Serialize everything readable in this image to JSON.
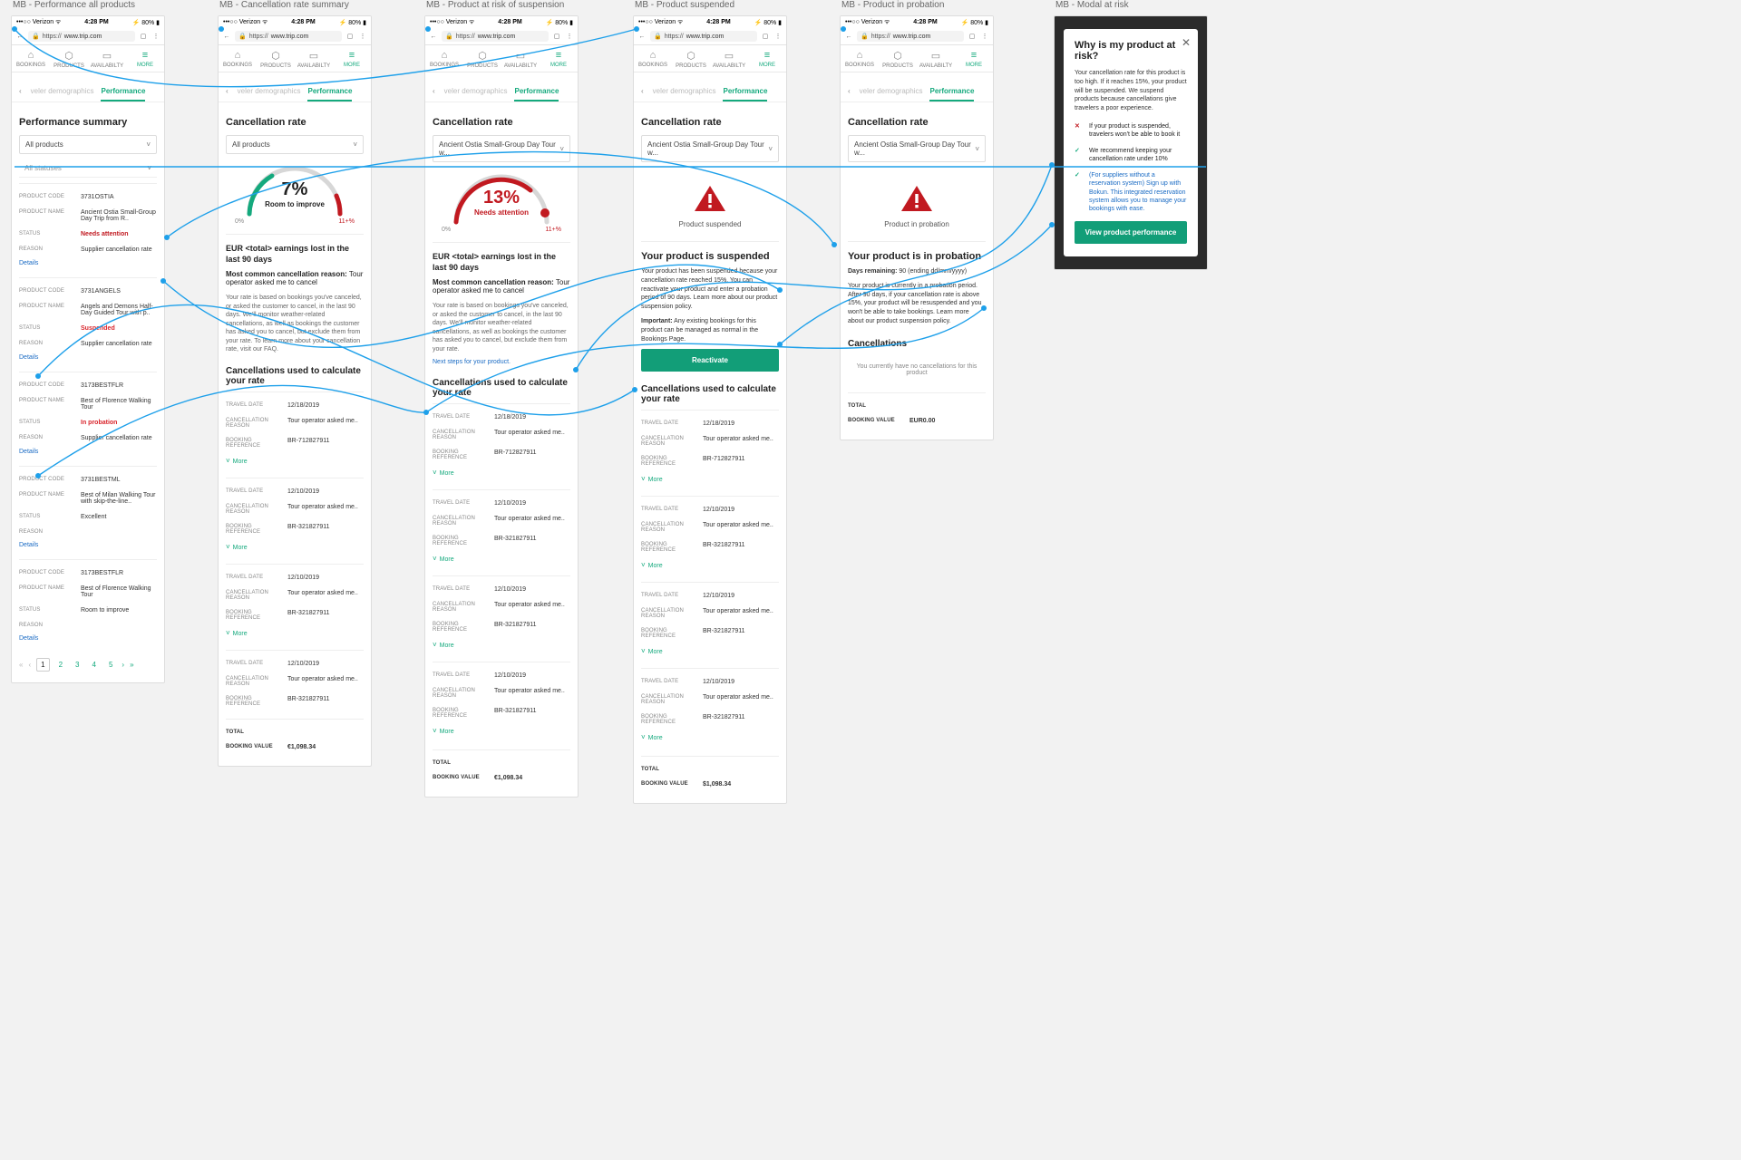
{
  "statusbar": {
    "carrier": "•••○○ Verizon ᯤ",
    "time": "4:28 PM",
    "battery": "⚡ 80% ▮"
  },
  "browser": {
    "url_prefix": "https://",
    "url": "www.trip.com"
  },
  "topnav": {
    "bookings": "BOOKINGS",
    "products": "PRODUCTS",
    "availability": "AVAILABILTY",
    "more": "MORE"
  },
  "subtabs": {
    "demographics": "veler demographics",
    "performance": "Performance"
  },
  "columns": {
    "c1": {
      "title": "MB - Performance all products"
    },
    "c2": {
      "title": "MB - Cancellation rate summary"
    },
    "c3": {
      "title": "MB - Product at risk of suspension"
    },
    "c4": {
      "title": "MB - Product suspended"
    },
    "c5": {
      "title": "MB - Product in probation"
    },
    "c6": {
      "title": "MB - Modal at risk"
    }
  },
  "perf": {
    "heading": "Performance summary",
    "filter1": "All products",
    "filter2": "All statuses",
    "field_labels": {
      "code": "PRODUCT CODE",
      "name": "PRODUCT NAME",
      "status": "STATUS",
      "reason": "REASON"
    },
    "details": "Details",
    "products": [
      {
        "code": "3731OSTIA",
        "name": "Ancient Ostia Small-Group Day Trip from R..",
        "status": "Needs attention",
        "status_class": "needs",
        "reason": "Supplier cancellation rate"
      },
      {
        "code": "3731ANGELS",
        "name": "Angels and Demons Half-Day Guided Tour with p..",
        "status": "Suspended",
        "status_class": "susp",
        "reason": "Supplier cancellation rate"
      },
      {
        "code": "3173BESTFLR",
        "name": "Best of Florence Walking Tour",
        "status": "In probation",
        "status_class": "prob",
        "reason": "Supplier cancellation rate"
      },
      {
        "code": "3731BESTML",
        "name": "Best of Milan Walking Tour with skip-the-line..",
        "status": "Excellent",
        "status_class": "",
        "reason": ""
      },
      {
        "code": "3173BESTFLR",
        "name": "Best of Florence Walking Tour",
        "status": "Room to improve",
        "status_class": "",
        "reason": ""
      }
    ],
    "pager": [
      "1",
      "2",
      "3",
      "4",
      "5"
    ]
  },
  "cxl": {
    "heading": "Cancellation rate",
    "filter_all": "All products",
    "filter_ostia": "Ancient Ostia Small-Group Day Tour w...",
    "gauge7": {
      "pct": "7%",
      "caption": "Room to improve"
    },
    "gauge13": {
      "pct": "13%",
      "caption": "Needs attention"
    },
    "gauge_labels": {
      "left": "0%",
      "right": "11+%"
    },
    "earnings": "EUR <total> earnings lost in the last 90 days",
    "common_reason_label": "Most common cancellation reason:",
    "common_reason_value": " Tour operator asked me to cancel",
    "fineprint_c2": "Your rate is based on bookings you've canceled, or asked the customer to cancel, in the last 90 days. We'll monitor weather-related cancellations, as well as bookings the customer has asked you to cancel, but exclude them from your rate. To learn more about your cancellation rate, visit our FAQ.",
    "fineprint_c3": "Your rate is based on bookings you've canceled, or asked the customer to cancel, in the last 90 days. We'll monitor weather-related cancellations, as well as bookings the customer has asked you to cancel, but exclude them from your rate.",
    "next_steps": "Next steps for your product.",
    "used_heading": "Cancellations used to calculate your rate",
    "row_labels": {
      "travel": "TRAVEL DATE",
      "reason": "CANCELLATION REASON",
      "ref": "BOOKING REFERENCE"
    },
    "more": "More",
    "row1": {
      "date": "12/18/2019",
      "reason": "Tour operator asked me..",
      "ref": "BR-712827911"
    },
    "row2": {
      "date": "12/10/2019",
      "reason": "Tour operator asked me..",
      "ref": "BR-321827911"
    },
    "total_label": "TOTAL",
    "booking_value_label": "BOOKING VALUE",
    "booking_value_eur": "€1,098.34",
    "booking_value_usd": "$1,098.34"
  },
  "suspended": {
    "icon_caption": "Product suspended",
    "title": "Your product is suspended",
    "body": "Your product has been suspended because your cancellation rate reached 15%. You can reactivate your product and enter a probation period of 90 days. Learn more about our product suspension policy.",
    "important_label": "Important:",
    "important_body": " Any existing bookings for this product can be managed as normal in the Bookings Page.",
    "cta": "Reactivate"
  },
  "probation": {
    "icon_caption": "Product in probation",
    "title": "Your product is in probation",
    "days_label": "Days remaining:",
    "days_value": " 90 (ending dd/mm/yyyy)",
    "body": "Your product is currently in a probation period. After 90 days, if your cancellation rate is above 15%, your product will be resuspended and you won't be able to take bookings. Learn more about our product suspension policy.",
    "cxl_heading": "Cancellations",
    "empty": "You currently have no cancellations for this product",
    "total_value": "EUR0.00"
  },
  "modal": {
    "title": "Why is my product at risk?",
    "body": "Your cancellation rate for this product is too high. If it reaches 15%, your product will be suspended. We suspend products because cancellations give travelers a poor experience.",
    "b1": "If your product is suspended, travelers won't be able to book it",
    "b2": "We recommend keeping your cancellation rate under 10%",
    "b3": "(For suppliers without a reservation system) Sign up with Bokun. This integrated reservation system allows you to manage your bookings with ease.",
    "cta": "View product performance"
  }
}
